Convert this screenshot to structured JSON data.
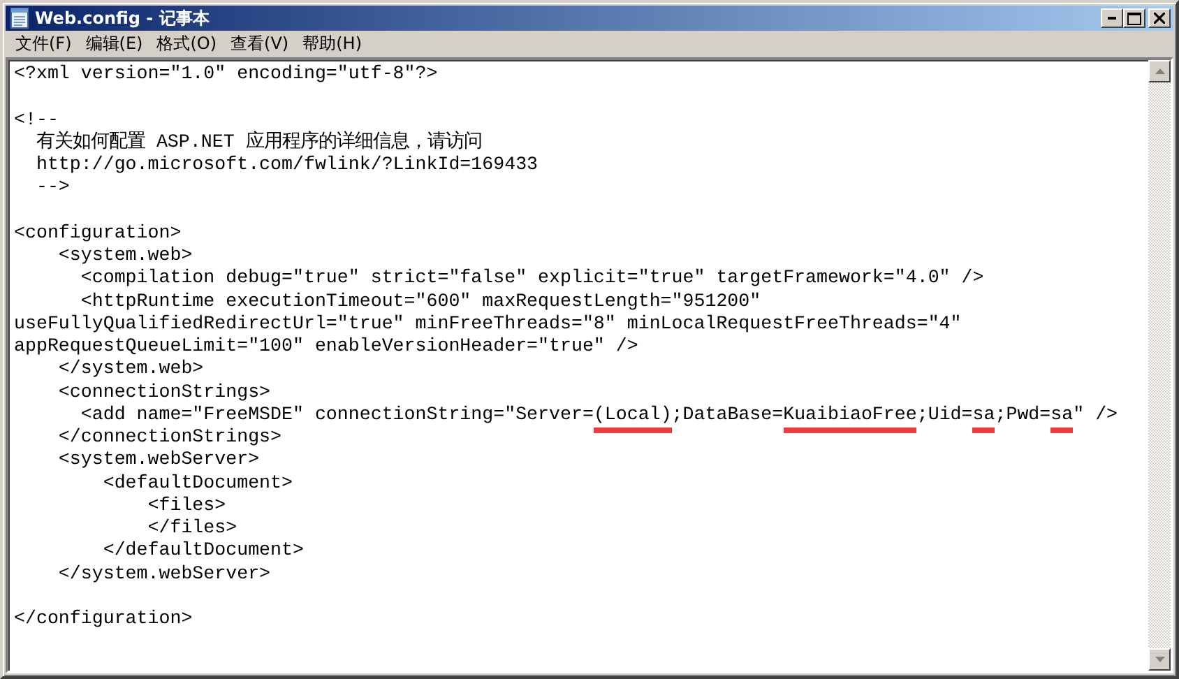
{
  "window": {
    "title": "Web.config - 记事本"
  },
  "menu": [
    "文件(F)",
    "编辑(E)",
    "格式(O)",
    "查看(V)",
    "帮助(H)"
  ],
  "editor": {
    "lines": [
      {
        "kind": "text",
        "text": "<?xml version=\"1.0\" encoding=\"utf-8\"?>"
      },
      {
        "kind": "blank"
      },
      {
        "kind": "text",
        "text": "<!--"
      },
      {
        "kind": "text",
        "text": "  有关如何配置 ASP.NET 应用程序的详细信息，请访问"
      },
      {
        "kind": "text",
        "text": "  http://go.microsoft.com/fwlink/?LinkId=169433"
      },
      {
        "kind": "text",
        "text": "  -->"
      },
      {
        "kind": "blank"
      },
      {
        "kind": "text",
        "text": "<configuration>"
      },
      {
        "kind": "text",
        "text": "    <system.web>"
      },
      {
        "kind": "text",
        "text": "      <compilation debug=\"true\" strict=\"false\" explicit=\"true\" targetFramework=\"4.0\" />"
      },
      {
        "kind": "text",
        "text": "      <httpRuntime executionTimeout=\"600\" maxRequestLength=\"951200\""
      },
      {
        "kind": "text",
        "text": "useFullyQualifiedRedirectUrl=\"true\" minFreeThreads=\"8\" minLocalRequestFreeThreads=\"4\""
      },
      {
        "kind": "text",
        "text": "appRequestQueueLimit=\"100\" enableVersionHeader=\"true\" />"
      },
      {
        "kind": "text",
        "text": "    </system.web>"
      },
      {
        "kind": "text",
        "text": "    <connectionStrings>"
      },
      {
        "kind": "marked",
        "segments": [
          {
            "text": "      <add name=\"FreeMSDE\" connectionString=\"Server=",
            "marked": false
          },
          {
            "text": "(Local)",
            "marked": true
          },
          {
            "text": ";DataBase=",
            "marked": false
          },
          {
            "text": "KuaibiaoFree",
            "marked": true
          },
          {
            "text": ";Uid=",
            "marked": false
          },
          {
            "text": "sa",
            "marked": true
          },
          {
            "text": ";Pwd=",
            "marked": false
          },
          {
            "text": "sa",
            "marked": true
          },
          {
            "text": "\" />",
            "marked": false
          }
        ]
      },
      {
        "kind": "text",
        "text": "    </connectionStrings>"
      },
      {
        "kind": "text",
        "text": "    <system.webServer>"
      },
      {
        "kind": "text",
        "text": "        <defaultDocument>"
      },
      {
        "kind": "text",
        "text": "            <files>"
      },
      {
        "kind": "text",
        "text": "            </files>"
      },
      {
        "kind": "text",
        "text": "        </defaultDocument>"
      },
      {
        "kind": "text",
        "text": "    </system.webServer>"
      },
      {
        "kind": "blank"
      },
      {
        "kind": "text",
        "text": "</configuration>"
      }
    ]
  }
}
